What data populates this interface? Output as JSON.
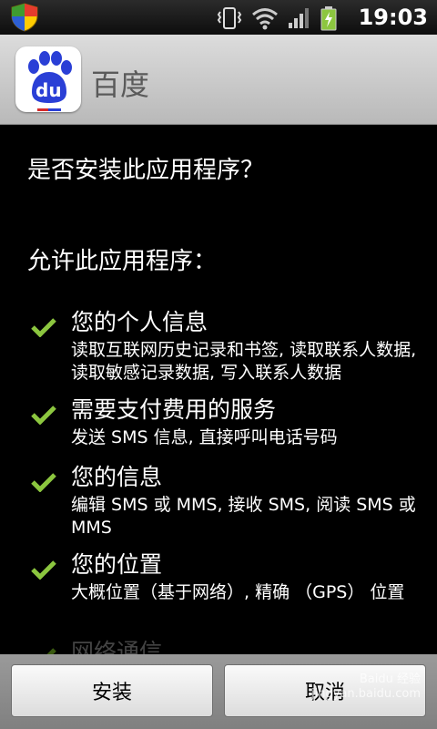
{
  "status_bar": {
    "time": "19:03",
    "icons": [
      "shield-icon",
      "vibrate-icon",
      "wifi-icon",
      "signal-icon",
      "battery-charging-icon"
    ]
  },
  "app": {
    "name": "百度",
    "logo_text": "du"
  },
  "dialog": {
    "question": "是否安装此应用程序？",
    "allow_heading": "允许此应用程序：",
    "permissions": [
      {
        "title": "您的个人信息",
        "description": "读取互联网历史记录和书签, 读取联系人数据, 读取敏感记录数据, 写入联系人数据"
      },
      {
        "title": "需要支付费用的服务",
        "description": "发送 SMS 信息, 直接呼叫电话号码"
      },
      {
        "title": "您的信息",
        "description": "编辑 SMS 或 MMS, 接收 SMS, 阅读 SMS 或 MMS"
      },
      {
        "title": "您的位置",
        "description": "大概位置（基于网络）, 精确 （GPS） 位置"
      },
      {
        "title": "网络通信",
        "description": ""
      }
    ]
  },
  "buttons": {
    "install": "安装",
    "cancel": "取消"
  },
  "watermark": {
    "line1": "Baidu 经验",
    "line2": "jingyan.baidu.com"
  },
  "colors": {
    "check_green": "#8cc63f",
    "header_bg": "#c8c8c8",
    "baidu_blue": "#2a3fd6"
  }
}
